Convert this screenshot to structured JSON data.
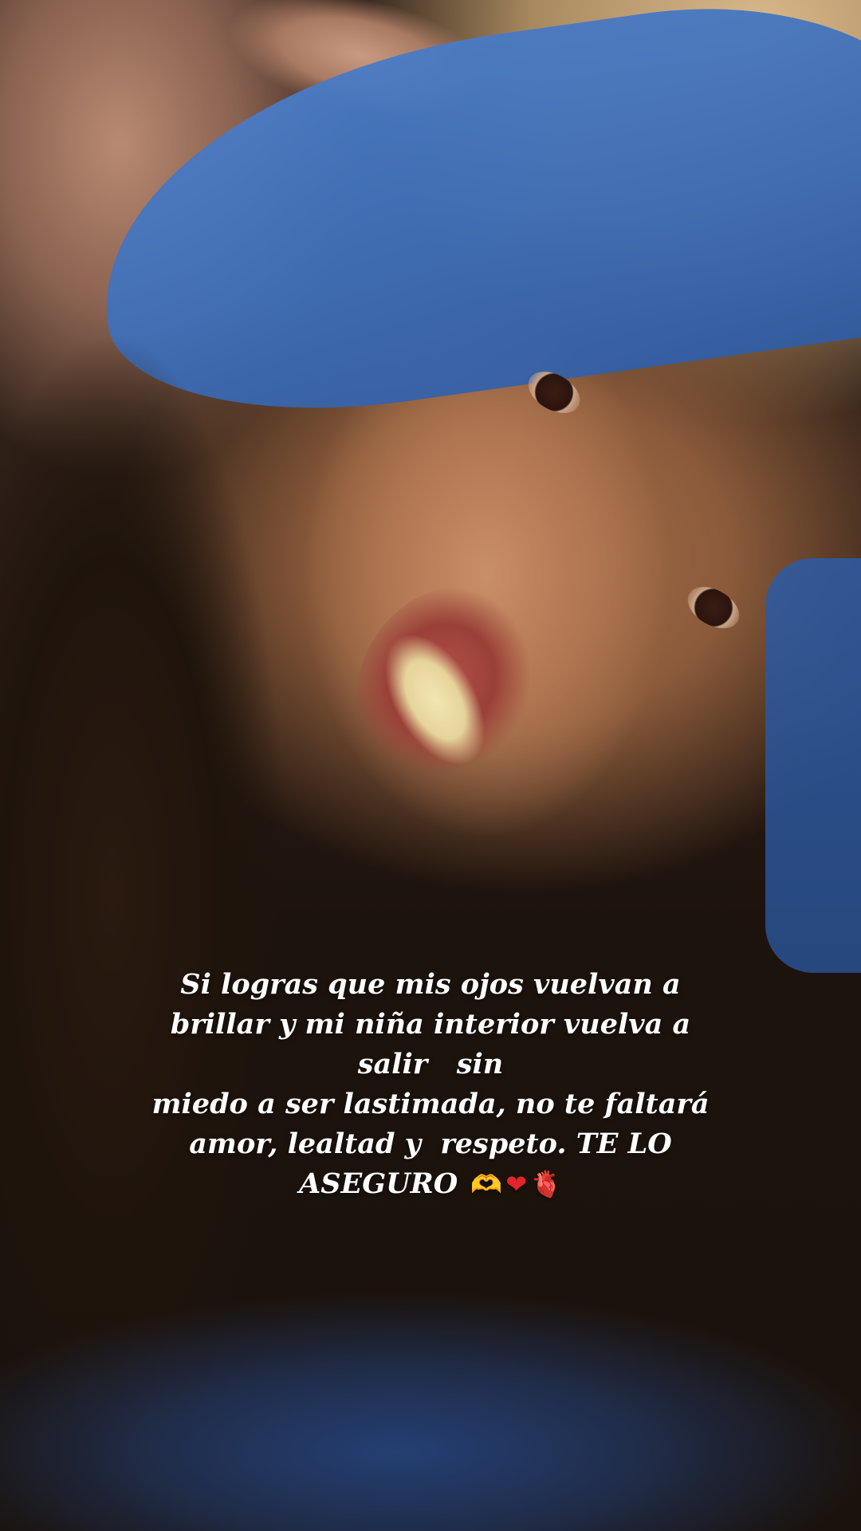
{
  "story": {
    "caption_lines": [
      "Si logras que mis ojos vuelvan a",
      "brillar y mi niña interior vuelva a",
      "salir   sin",
      "miedo a ser lastimada, no te faltará",
      "amor, lealtad y  respeto. TE LO",
      "ASEGURO"
    ],
    "emojis": [
      {
        "name": "heart-hands",
        "glyph": "🫶"
      },
      {
        "name": "red-heart",
        "glyph": "❤"
      },
      {
        "name": "anatomical-heart",
        "glyph": "🫀"
      }
    ]
  }
}
